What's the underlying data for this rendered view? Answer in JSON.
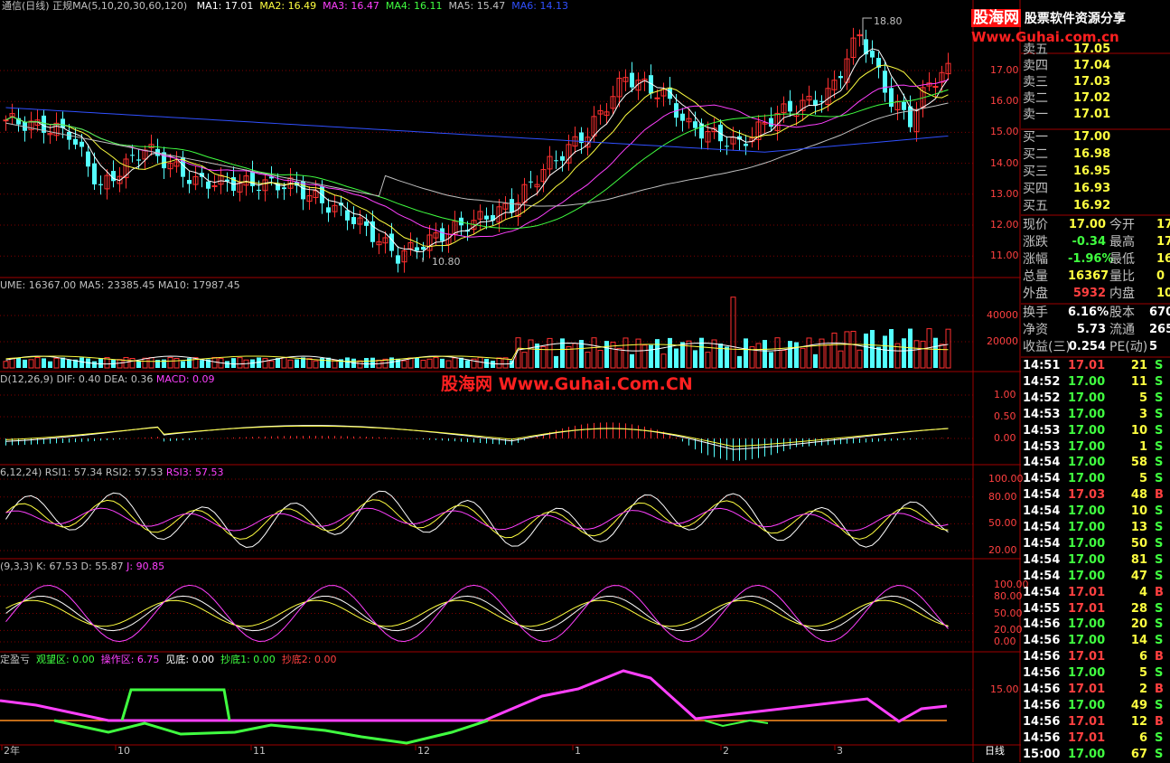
{
  "header": {
    "title": "通信(日线)",
    "ma_spec": "正规MA(5,10,20,30,60,120)",
    "ma_values": [
      {
        "label": "MA1: 17.01",
        "color": "#ffffff"
      },
      {
        "label": "MA2: 16.49",
        "color": "#ffff40"
      },
      {
        "label": "MA3: 16.47",
        "color": "#ff40ff"
      },
      {
        "label": "MA4: 16.11",
        "color": "#40ff40"
      },
      {
        "label": "MA5: 15.47",
        "color": "#c0c0c0"
      },
      {
        "label": "MA6: 14.13",
        "color": "#3050ff"
      }
    ]
  },
  "brand": {
    "name": "股海网",
    "tagline": "股票软件资源分享",
    "url": "Www.Guhai.com.cn"
  },
  "watermark": "股海网 Www.Guhai.Com.CN",
  "price_chart": {
    "high_label": "18.80",
    "low_label": "10.80",
    "y_ticks": [
      "17.00",
      "16.00",
      "15.00",
      "14.00",
      "13.00",
      "12.00",
      "11.00"
    ]
  },
  "volume_panel": {
    "header": "UME: 16367.00  MA5: 23385.45  MA10: 17987.45",
    "y_ticks": [
      "40000",
      "20000"
    ]
  },
  "macd_panel": {
    "header_a": "D(12,26,9)  DIF: 0.40  DEA: 0.36",
    "header_b": "MACD: 0.09",
    "y_ticks": [
      "1.00",
      "0.50",
      "0.00"
    ]
  },
  "rsi_panel": {
    "header_a": "6,12,24)  RSI1: 57.34  RSI2: 57.53",
    "header_b": "RSI3: 57.53",
    "y_ticks": [
      "100.00",
      "80.00",
      "50.00",
      "20.00"
    ]
  },
  "kdj_panel": {
    "header_a": "(9,3,3)  K: 67.53  D: 55.87",
    "header_b": "J: 90.85",
    "y_ticks": [
      "100.00",
      "80.00",
      "50.00",
      "20.00",
      "0.00"
    ]
  },
  "profit_panel": {
    "items": [
      {
        "text": "定盈亏",
        "color": "#c0c0c0"
      },
      {
        "text": "观望区: 0.00",
        "color": "#40ff40"
      },
      {
        "text": "操作区: 6.75",
        "color": "#ff40ff"
      },
      {
        "text": "见底: 0.00",
        "color": "#ffffff"
      },
      {
        "text": "抄底1: 0.00",
        "color": "#40ff40"
      },
      {
        "text": "抄底2: 0.00",
        "color": "#ff4040"
      }
    ],
    "y_ticks": [
      "15.00"
    ]
  },
  "x_axis": {
    "labels": [
      "2年",
      "10",
      "11",
      "12",
      "1",
      "2",
      "3"
    ],
    "period": "日线"
  },
  "order_book": [
    {
      "label": "卖五",
      "price": "17.05"
    },
    {
      "label": "卖四",
      "price": "17.04"
    },
    {
      "label": "卖三",
      "price": "17.03"
    },
    {
      "label": "卖二",
      "price": "17.02"
    },
    {
      "label": "卖一",
      "price": "17.01"
    },
    {
      "label": "买一",
      "price": "17.00"
    },
    {
      "label": "买二",
      "price": "16.98"
    },
    {
      "label": "买三",
      "price": "16.95"
    },
    {
      "label": "买四",
      "price": "16.93"
    },
    {
      "label": "买五",
      "price": "16.92"
    }
  ],
  "stats": [
    {
      "l1": "现价",
      "v1": "17.00",
      "c1": "#ffff40",
      "l2": "今开",
      "v2": "17"
    },
    {
      "l1": "涨跌",
      "v1": "-0.34",
      "c1": "#40ff40",
      "l2": "最高",
      "v2": "17"
    },
    {
      "l1": "涨幅",
      "v1": "-1.96%",
      "c1": "#40ff40",
      "l2": "最低",
      "v2": "16"
    },
    {
      "l1": "总量",
      "v1": "16367",
      "c1": "#ffff40",
      "l2": "量比",
      "v2": "0"
    },
    {
      "l1": "外盘",
      "v1": "5932",
      "c1": "#ff4040",
      "l2": "内盘",
      "v2": "10"
    }
  ],
  "stats2": [
    {
      "l1": "换手",
      "v1": "6.16%",
      "l2": "股本",
      "v2": "670"
    },
    {
      "l1": "净资",
      "v1": "5.73",
      "l2": "流通",
      "v2": "265"
    },
    {
      "l1": "收益(三)",
      "v1": "0.254",
      "l2": "PE(动)",
      "v2": "5"
    }
  ],
  "ticks": [
    {
      "time": "14:51",
      "price": "17.01",
      "vol": "21",
      "side": "S"
    },
    {
      "time": "14:52",
      "price": "17.00",
      "vol": "11",
      "side": "S"
    },
    {
      "time": "14:52",
      "price": "17.00",
      "vol": "5",
      "side": "S"
    },
    {
      "time": "14:53",
      "price": "17.00",
      "vol": "3",
      "side": "S"
    },
    {
      "time": "14:53",
      "price": "17.00",
      "vol": "10",
      "side": "S"
    },
    {
      "time": "14:53",
      "price": "17.00",
      "vol": "1",
      "side": "S"
    },
    {
      "time": "14:54",
      "price": "17.00",
      "vol": "58",
      "side": "S"
    },
    {
      "time": "14:54",
      "price": "17.00",
      "vol": "5",
      "side": "S"
    },
    {
      "time": "14:54",
      "price": "17.03",
      "vol": "48",
      "side": "B"
    },
    {
      "time": "14:54",
      "price": "17.00",
      "vol": "10",
      "side": "S"
    },
    {
      "time": "14:54",
      "price": "17.00",
      "vol": "13",
      "side": "S"
    },
    {
      "time": "14:54",
      "price": "17.00",
      "vol": "50",
      "side": "S"
    },
    {
      "time": "14:54",
      "price": "17.00",
      "vol": "81",
      "side": "S"
    },
    {
      "time": "14:54",
      "price": "17.00",
      "vol": "47",
      "side": "S"
    },
    {
      "time": "14:54",
      "price": "17.01",
      "vol": "4",
      "side": "B"
    },
    {
      "time": "14:55",
      "price": "17.01",
      "vol": "28",
      "side": "S"
    },
    {
      "time": "14:56",
      "price": "17.00",
      "vol": "20",
      "side": "S"
    },
    {
      "time": "14:56",
      "price": "17.00",
      "vol": "14",
      "side": "S"
    },
    {
      "time": "14:56",
      "price": "17.01",
      "vol": "6",
      "side": "B"
    },
    {
      "time": "14:56",
      "price": "17.00",
      "vol": "5",
      "side": "S"
    },
    {
      "time": "14:56",
      "price": "17.01",
      "vol": "2",
      "side": "B"
    },
    {
      "time": "14:56",
      "price": "17.00",
      "vol": "49",
      "side": "S"
    },
    {
      "time": "14:56",
      "price": "17.01",
      "vol": "12",
      "side": "B"
    },
    {
      "time": "14:56",
      "price": "17.01",
      "vol": "6",
      "side": "S"
    },
    {
      "time": "15:00",
      "price": "17.00",
      "vol": "67",
      "side": "S"
    }
  ]
}
